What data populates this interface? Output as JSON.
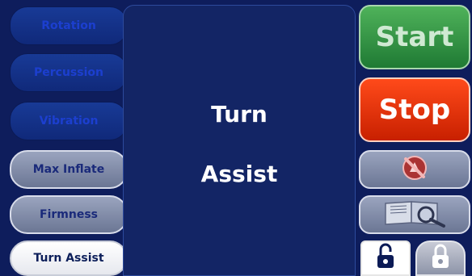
{
  "left_buttons": [
    {
      "label": "Rotation",
      "state": "disabled"
    },
    {
      "label": "Percussion",
      "state": "disabled"
    },
    {
      "label": "Vibration",
      "state": "disabled"
    },
    {
      "label": "Max Inflate",
      "state": "enabled"
    },
    {
      "label": "Firmness",
      "state": "enabled"
    },
    {
      "label": "Turn Assist",
      "state": "selected"
    }
  ],
  "center": {
    "line1": "Turn",
    "line2": "Assist"
  },
  "right_buttons": {
    "start_label": "Start",
    "stop_label": "Stop",
    "mute_icon": "alarm-mute-icon",
    "manual_icon": "manual-search-icon",
    "unlock_icon": "unlocked-padlock-icon",
    "lock_icon": "locked-padlock-icon"
  },
  "colors": {
    "background": "#0e1d5c",
    "start": "#3a9a48",
    "stop": "#e83010"
  }
}
